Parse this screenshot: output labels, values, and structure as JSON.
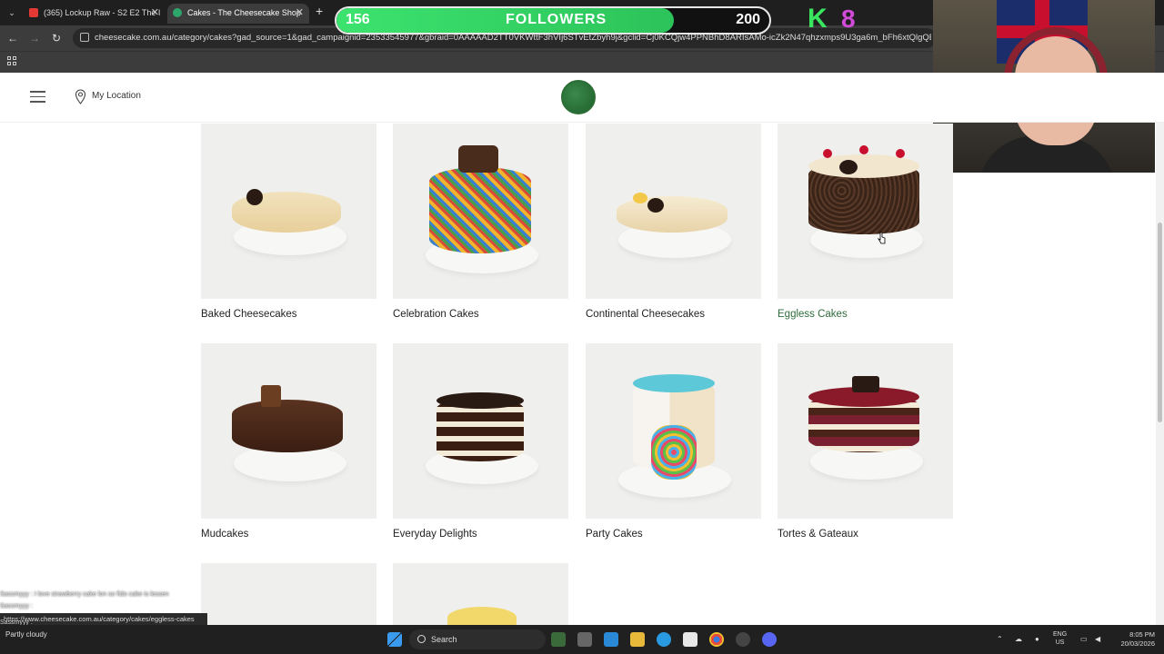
{
  "browser": {
    "tabs": [
      {
        "title": "(365) Lockup Raw - S2 E2 The I"
      },
      {
        "title": "Cakes - The Cheesecake Shop"
      }
    ],
    "url": "cheesecake.com.au/category/cakes?gad_source=1&gad_campaignid=23533545977&gbraid=0AAAAAD2TT0VKWttF3hVIj6STvEtZbyh9j&gclid=Cj0KCQjw4PPNBhD8ARIsAMo-icZk2N47qhzxmps9U3ga6m_bFh6xtQlgQBy26S1h5"
  },
  "overlay": {
    "followers_current": "156",
    "followers_label": "FOLLOWERS",
    "followers_goal": "200",
    "followers_progress": 0.78,
    "kick_letter": "K",
    "kick_count": "8"
  },
  "site": {
    "location_label": "My Location",
    "categories": [
      {
        "label": "Baked Cheesecakes",
        "active": false
      },
      {
        "label": "Celebration Cakes",
        "active": false
      },
      {
        "label": "Continental Cheesecakes",
        "active": false
      },
      {
        "label": "Eggless Cakes",
        "active": true
      },
      {
        "label": "Mudcakes",
        "active": false
      },
      {
        "label": "Everyday Delights",
        "active": false
      },
      {
        "label": "Party Cakes",
        "active": false
      },
      {
        "label": "Tortes & Gateaux",
        "active": false
      }
    ]
  },
  "chat": [
    "Sassmyyy : I love strawberry cake lon so fido cake is lessen",
    "Sassmyyy :",
    "Sassmyyy :",
    "Sassmyyy :",
    "Partly cloudy"
  ],
  "status_url": "https://www.cheesecake.com.au/category/cakes/eggless-cakes",
  "taskbar": {
    "search_label": "Search",
    "lang_top": "ENG",
    "lang_bottom": "US",
    "time": "8:05 PM",
    "date": "20/03/2026"
  }
}
